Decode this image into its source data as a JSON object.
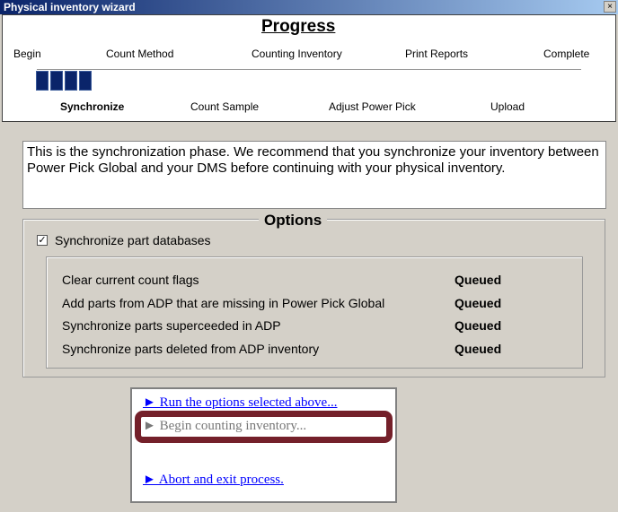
{
  "window": {
    "title": "Physical inventory wizard",
    "close": "×"
  },
  "progress": {
    "title": "Progress",
    "top_steps": [
      "Begin",
      "Count Method",
      "Counting Inventory",
      "Print Reports",
      "Complete"
    ],
    "bottom_steps": [
      "Synchronize",
      "Count Sample",
      "Adjust Power Pick",
      "Upload"
    ],
    "current_step": "Synchronize",
    "completed_blocks": 4
  },
  "description": "This is the synchronization phase.  We recommend that you synchronize your inventory between Power Pick Global and your DMS before continuing with your physical inventory.",
  "options": {
    "title": "Options",
    "sync_checkbox": {
      "label": "Synchronize part databases",
      "checked": true,
      "mark": "✓"
    },
    "rows": [
      {
        "label": "Clear current count flags",
        "status": "Queued"
      },
      {
        "label": "Add parts from ADP that are missing in Power Pick Global",
        "status": "Queued"
      },
      {
        "label": "Synchronize parts superceeded in ADP",
        "status": "Queued"
      },
      {
        "label": "Synchronize parts deleted from ADP inventory",
        "status": "Queued"
      }
    ]
  },
  "actions": {
    "run": "► Run the options selected above...",
    "begin": "► Begin counting inventory...",
    "abort": "► Abort and exit process."
  },
  "colors": {
    "link": "#0000ff",
    "highlight": "#74202a",
    "progress": "#0a246a"
  }
}
